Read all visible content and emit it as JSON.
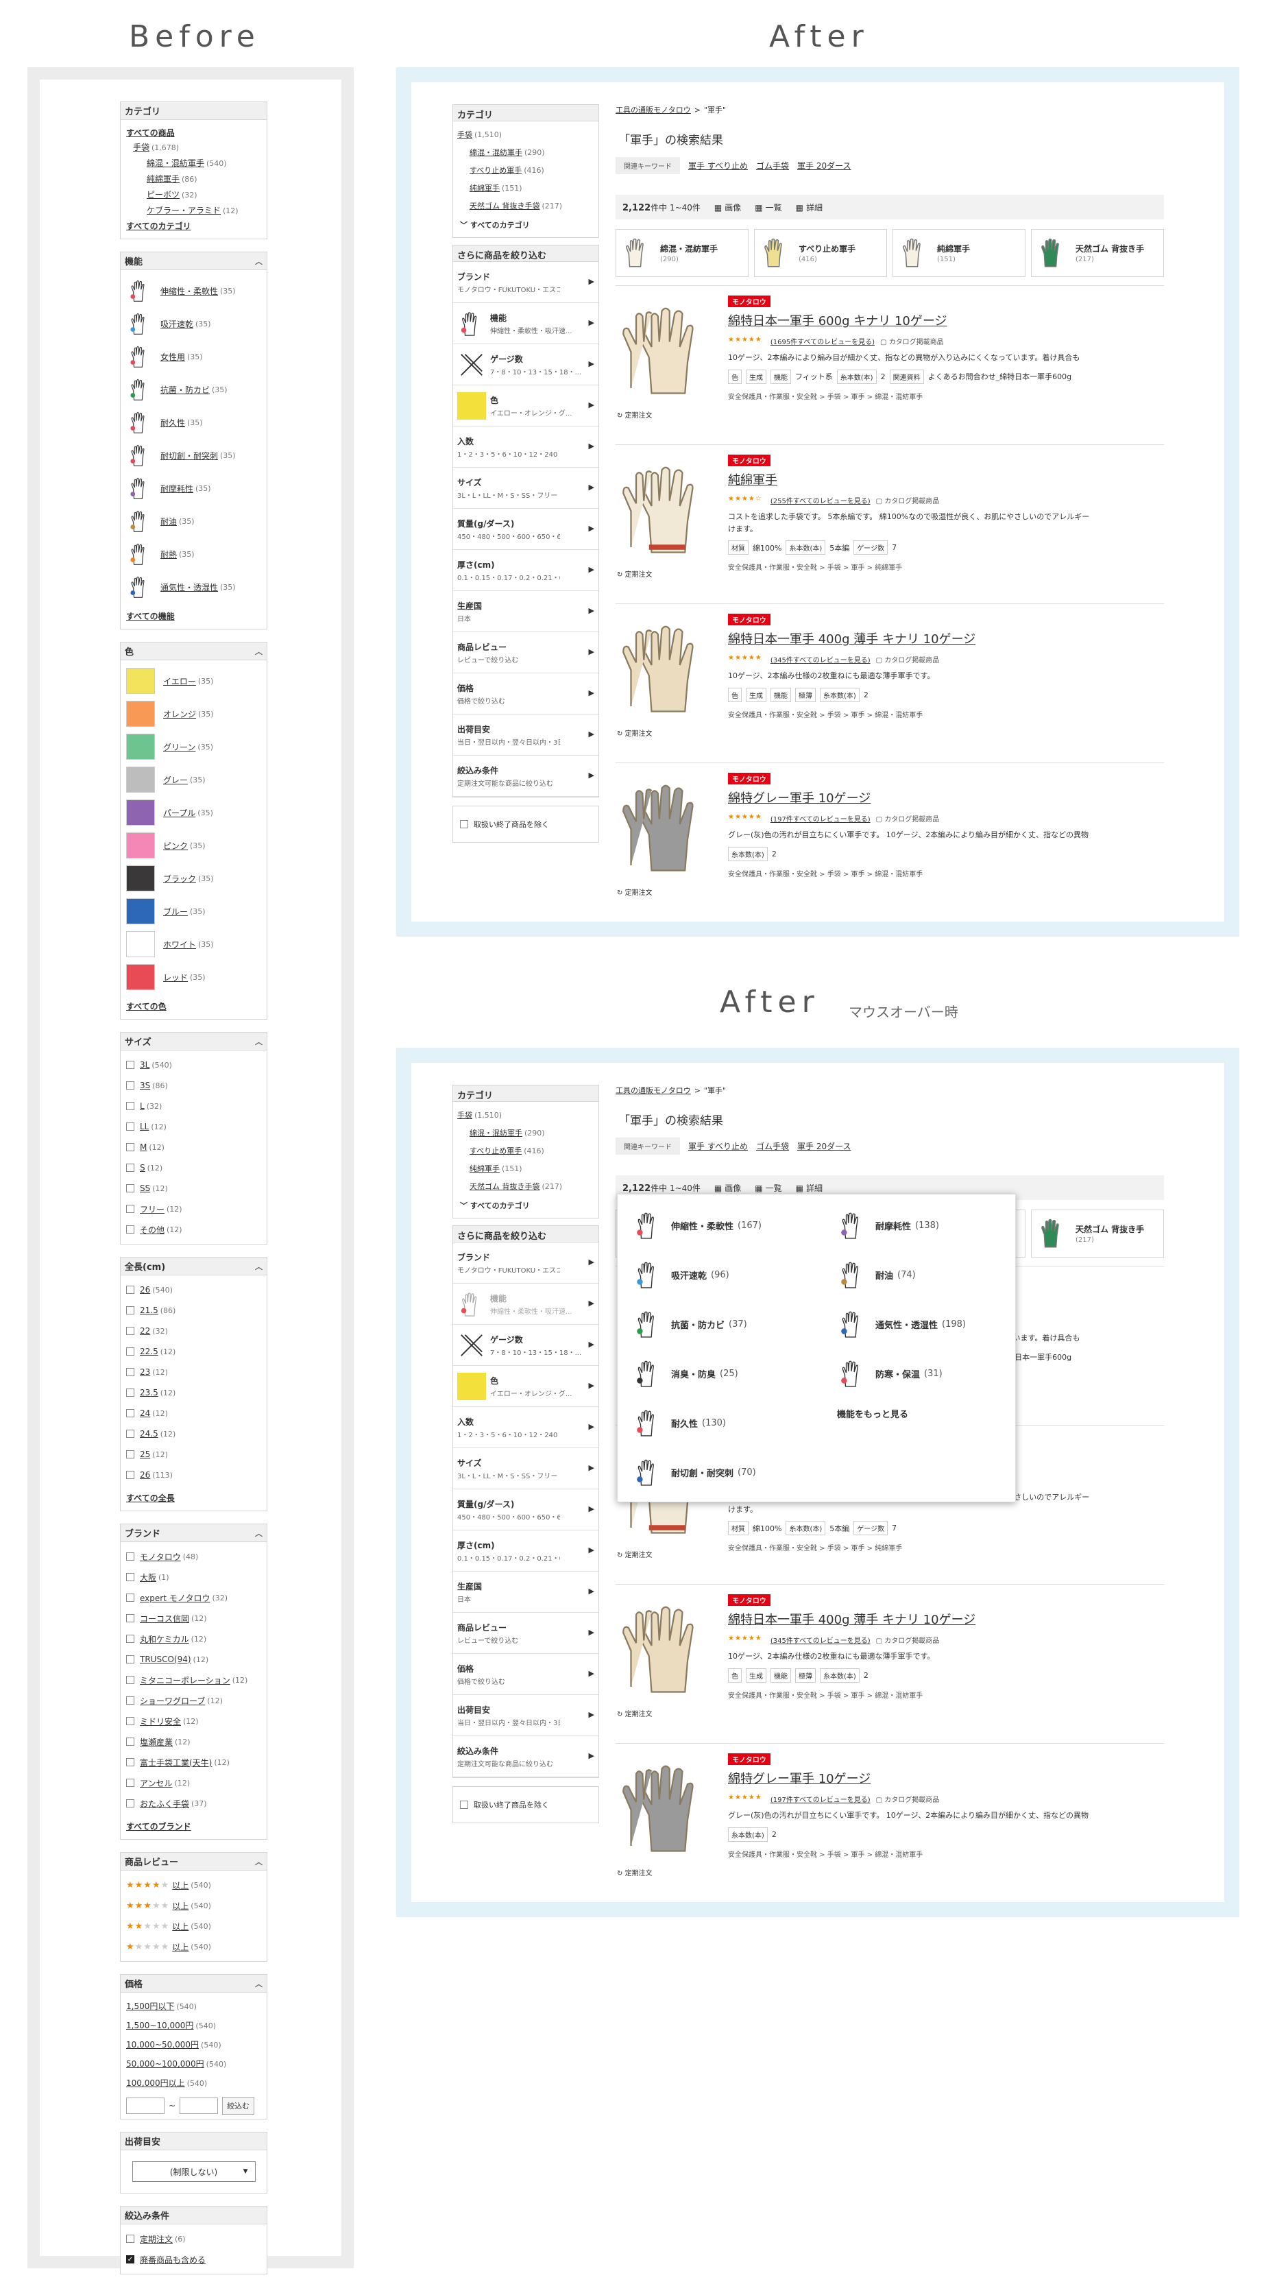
{
  "headings": {
    "before": "Before",
    "after": "After",
    "after2": "After",
    "hover_note": "マウスオーバー時"
  },
  "before": {
    "category": {
      "title": "カテゴリ",
      "all": "すべての商品",
      "l1": {
        "label": "手袋",
        "count": "(1,678)"
      },
      "l2": [
        {
          "label": "綿混・混紡軍手",
          "count": "(540)"
        },
        {
          "label": "純綿軍手",
          "count": "(86)"
        },
        {
          "label": "ピーボツ",
          "count": "(32)"
        },
        {
          "label": "ケブラー・アラミド",
          "count": "(12)"
        }
      ],
      "all_link": "すべてのカテゴリ"
    },
    "function": {
      "title": "機能",
      "items": [
        {
          "label": "伸縮性・柔軟性",
          "count": "(35)"
        },
        {
          "label": "吸汗速乾",
          "count": "(35)"
        },
        {
          "label": "女性用",
          "count": "(35)"
        },
        {
          "label": "抗菌・防カビ",
          "count": "(35)"
        },
        {
          "label": "耐久性",
          "count": "(35)"
        },
        {
          "label": "耐切創・耐突刺",
          "count": "(35)"
        },
        {
          "label": "耐摩耗性",
          "count": "(35)"
        },
        {
          "label": "耐油",
          "count": "(35)"
        },
        {
          "label": "耐熱",
          "count": "(35)"
        },
        {
          "label": "通気性・透湿性",
          "count": "(35)"
        }
      ],
      "all_link": "すべての機能"
    },
    "color": {
      "title": "色",
      "items": [
        {
          "label": "イエロー",
          "count": "(35)",
          "hex": "#f3e35c"
        },
        {
          "label": "オレンジ",
          "count": "(35)",
          "hex": "#f89a55"
        },
        {
          "label": "グリーン",
          "count": "(35)",
          "hex": "#6dc48e"
        },
        {
          "label": "グレー",
          "count": "(35)",
          "hex": "#bdbdbd"
        },
        {
          "label": "パープル",
          "count": "(35)",
          "hex": "#8e63b0"
        },
        {
          "label": "ピンク",
          "count": "(35)",
          "hex": "#f487b6"
        },
        {
          "label": "ブラック",
          "count": "(35)",
          "hex": "#3a3838"
        },
        {
          "label": "ブルー",
          "count": "(35)",
          "hex": "#2d67b7"
        },
        {
          "label": "ホワイト",
          "count": "(35)",
          "hex": "#ffffff"
        },
        {
          "label": "レッド",
          "count": "(35)",
          "hex": "#e84a56"
        }
      ],
      "all_link": "すべての色"
    },
    "size": {
      "title": "サイズ",
      "items": [
        {
          "label": "3L",
          "count": "(540)"
        },
        {
          "label": "3S",
          "count": "(86)"
        },
        {
          "label": "L",
          "count": "(32)"
        },
        {
          "label": "LL",
          "count": "(12)"
        },
        {
          "label": "M",
          "count": "(12)"
        },
        {
          "label": "S",
          "count": "(12)"
        },
        {
          "label": "SS",
          "count": "(12)"
        },
        {
          "label": "フリー",
          "count": "(12)"
        },
        {
          "label": "その他",
          "count": "(12)"
        }
      ]
    },
    "length": {
      "title": "全長(cm)",
      "items": [
        {
          "label": "26",
          "count": "(540)"
        },
        {
          "label": "21.5",
          "count": "(86)"
        },
        {
          "label": "22",
          "count": "(32)"
        },
        {
          "label": "22.5",
          "count": "(12)"
        },
        {
          "label": "23",
          "count": "(12)"
        },
        {
          "label": "23.5",
          "count": "(12)"
        },
        {
          "label": "24",
          "count": "(12)"
        },
        {
          "label": "24.5",
          "count": "(12)"
        },
        {
          "label": "25",
          "count": "(12)"
        },
        {
          "label": "26",
          "count": "(113)"
        }
      ],
      "all_link": "すべての全長"
    },
    "brand": {
      "title": "ブランド",
      "items": [
        {
          "label": "モノタロウ",
          "count": "(48)"
        },
        {
          "label": "大阪",
          "count": "(1)"
        },
        {
          "label": "expert モノタロウ",
          "count": "(32)"
        },
        {
          "label": "コーコス信岡",
          "count": "(12)"
        },
        {
          "label": "丸和ケミカル",
          "count": "(12)"
        },
        {
          "label": "TRUSCO(94)",
          "count": "(12)"
        },
        {
          "label": "ミタニコーポレーション",
          "count": "(12)"
        },
        {
          "label": "ショーワグローブ",
          "count": "(12)"
        },
        {
          "label": "ミドリ安全",
          "count": "(12)"
        },
        {
          "label": "塩瀬産業",
          "count": "(12)"
        },
        {
          "label": "富士手袋工業(天牛)",
          "count": "(12)"
        },
        {
          "label": "アンセル",
          "count": "(12)"
        },
        {
          "label": "おたふく手袋",
          "count": "(37)"
        }
      ],
      "all_link": "すべてのブランド"
    },
    "review": {
      "title": "商品レビュー",
      "items": [
        {
          "stars": 4,
          "label": "以上",
          "count": "(540)"
        },
        {
          "stars": 3,
          "label": "以上",
          "count": "(540)"
        },
        {
          "stars": 2,
          "label": "以上",
          "count": "(540)"
        },
        {
          "stars": 1,
          "label": "以上",
          "count": "(540)"
        }
      ]
    },
    "price": {
      "title": "価格",
      "items": [
        {
          "label": "1,500円以下",
          "count": "(540)"
        },
        {
          "label": "1,500~10,000円",
          "count": "(540)"
        },
        {
          "label": "10,000~50,000円",
          "count": "(540)"
        },
        {
          "label": "50,000~100,000円",
          "count": "(540)"
        },
        {
          "label": "100,000円以上",
          "count": "(540)"
        }
      ],
      "tilde": "~",
      "button": "絞込む"
    },
    "ship": {
      "title": "出荷目安",
      "select": "(制限しない)"
    },
    "narrow": {
      "title": "絞込み条件",
      "items": [
        {
          "label": "定期注文",
          "count": "(6)",
          "checked": false
        },
        {
          "label": "廃番商品も含める",
          "count": "",
          "checked": true
        }
      ]
    }
  },
  "after": {
    "category": {
      "title": "カテゴリ",
      "l1": {
        "label": "手袋",
        "count": "(1,510)"
      },
      "l2": [
        {
          "label": "綿混・混紡軍手",
          "count": "(290)"
        },
        {
          "label": "すべり止め軍手",
          "count": "(416)"
        },
        {
          "label": "純綿軍手",
          "count": "(151)"
        },
        {
          "label": "天然ゴム 背抜き手袋",
          "count": "(217)"
        }
      ],
      "all_link": "すべてのカテゴリ"
    },
    "refine_title": "さらに商品を絞り込む",
    "filters": [
      {
        "label": "ブランド",
        "sub": "モノタロウ・FUKUTOKU・エスコ..."
      },
      {
        "label": "機能",
        "sub": "伸縮性・柔軟性・吸汗速..."
      },
      {
        "label": "ゲージ数",
        "sub": "7・8・10・13・15・18・..."
      },
      {
        "label": "色",
        "sub": "イエロー・オレンジ・グ..."
      },
      {
        "label": "入数",
        "sub": "1・2・3・5・6・10・12・240・4..."
      },
      {
        "label": "サイズ",
        "sub": "3L・L・LL・M・S・SS・フリー・..."
      },
      {
        "label": "質量(g/ダース)",
        "sub": "450・480・500・600・650・680・..."
      },
      {
        "label": "厚さ(cm)",
        "sub": "0.1・0.15・0.17・0.2・0.21・0..."
      },
      {
        "label": "生産国",
        "sub": "日本"
      },
      {
        "label": "商品レビュー",
        "sub": "レビューで絞り込む"
      },
      {
        "label": "価格",
        "sub": "価格で絞り込む"
      },
      {
        "label": "出荷目安",
        "sub": "当日・翌日以内・翌々日以内・3日..."
      },
      {
        "label": "絞込み条件",
        "sub": "定期注文可能な商品に絞り込む"
      }
    ],
    "discontinued": "取扱い終了商品を除く",
    "crumb": {
      "home": "工具の通販モノタロウ",
      "sep": ">",
      "term": "\"軍手\""
    },
    "result_title": "「軍手」の検索結果",
    "kw_tag": "関連キーワード",
    "keywords": [
      "軍手 すべり止め",
      "ゴム手袋",
      "軍手 20ダース"
    ],
    "count_text": "2,122",
    "count_suffix": "件中 1~40件",
    "views": [
      "画像",
      "一覧",
      "詳細"
    ],
    "chips": [
      {
        "label": "綿混・混紡軍手",
        "count": "(290)"
      },
      {
        "label": "すべり止め軍手",
        "count": "(416)"
      },
      {
        "label": "純綿軍手",
        "count": "(151)"
      },
      {
        "label": "天然ゴム 背抜き手",
        "count": "(217)"
      }
    ],
    "brand_tag": "モノタロウ",
    "teiki": "定期注文",
    "products": [
      {
        "name": "綿特日本一軍手 600g キナリ 10ゲージ",
        "stars": "★★★★★",
        "reviews": "(1695件すべてのレビューを見る)",
        "catalog": "カタログ掲載商品",
        "desc_a": "10ゲージ、2本編みにより編み目が細かく丈、指などの異物が入り込みにくくなっています。着け具合も",
        "desc_b": "",
        "specs": [
          {
            "k": "色",
            "v": ""
          },
          {
            "k": "生成",
            "v": ""
          },
          {
            "k": "機能",
            "v": "フィット系"
          },
          {
            "k": "糸本数(本)",
            "v": "2"
          },
          {
            "k": "関連資料",
            "v": "よくあるお問合わせ_綿特日本一軍手600g"
          }
        ],
        "path": "安全保護具・作業服・安全靴 > 手袋 > 軍手 > 綿混・混紡軍手",
        "color": "#efe2c8"
      },
      {
        "name": "純綿軍手",
        "stars": "★★★★☆",
        "reviews": "(255件すべてのレビューを見る)",
        "catalog": "カタログ掲載商品",
        "desc_a": "コストを追求した手袋です。 5本糸編です。 綿100%なので吸湿性が良く、お肌にやさしいのでアレルギー",
        "desc_b": "けます。",
        "specs": [
          {
            "k": "材質",
            "v": "綿100%"
          },
          {
            "k": "糸本数(本)",
            "v": "5本編"
          },
          {
            "k": "ゲージ数",
            "v": "7"
          }
        ],
        "path": "安全保護具・作業服・安全靴 > 手袋 > 軍手 > 純綿軍手",
        "color": "#f1e8d6"
      },
      {
        "name": "綿特日本一軍手 400g 薄手 キナリ 10ゲージ",
        "stars": "★★★★★",
        "reviews": "(345件すべてのレビューを見る)",
        "catalog": "カタログ掲載商品",
        "desc_a": "10ゲージ、2本編み仕様の2枚重ねにも最適な薄手軍手です。",
        "desc_b": "",
        "specs": [
          {
            "k": "色",
            "v": ""
          },
          {
            "k": "生成",
            "v": ""
          },
          {
            "k": "機能",
            "v": ""
          },
          {
            "k": "極薄",
            "v": ""
          },
          {
            "k": "糸本数(本)",
            "v": "2"
          }
        ],
        "path": "安全保護具・作業服・安全靴 > 手袋 > 軍手 > 綿混・混紡軍手",
        "color": "#ecdcbf"
      },
      {
        "name": "綿特グレー軍手 10ゲージ",
        "stars": "★★★★★",
        "reviews": "(197件すべてのレビューを見る)",
        "catalog": "カタログ掲載商品",
        "desc_a": "グレー(灰)色の汚れが目立ちにくい軍手です。 10ゲージ、2本編みにより編み目が細かく丈、指などの異物",
        "desc_b": "",
        "specs": [
          {
            "k": "糸本数(本)",
            "v": "2"
          }
        ],
        "path": "安全保護具・作業服・安全靴 > 手袋 > 軍手 > 綿混・混紡軍手",
        "color": "#9a9a9a"
      }
    ],
    "popup": {
      "items": [
        {
          "label": "伸縮性・柔軟性",
          "count": "(167)"
        },
        {
          "label": "耐摩耗性",
          "count": "(138)"
        },
        {
          "label": "吸汗速乾",
          "count": "(96)"
        },
        {
          "label": "耐油",
          "count": "(74)"
        },
        {
          "label": "抗菌・防カビ",
          "count": "(37)"
        },
        {
          "label": "通気性・透湿性",
          "count": "(198)"
        },
        {
          "label": "消臭・防臭",
          "count": "(25)"
        },
        {
          "label": "防寒・保温",
          "count": "(31)"
        },
        {
          "label": "耐久性",
          "count": "(130)"
        },
        {
          "label": "機能をもっと見る",
          "count": ""
        },
        {
          "label": "耐切創・耐突刺",
          "count": "(70)"
        }
      ]
    }
  }
}
